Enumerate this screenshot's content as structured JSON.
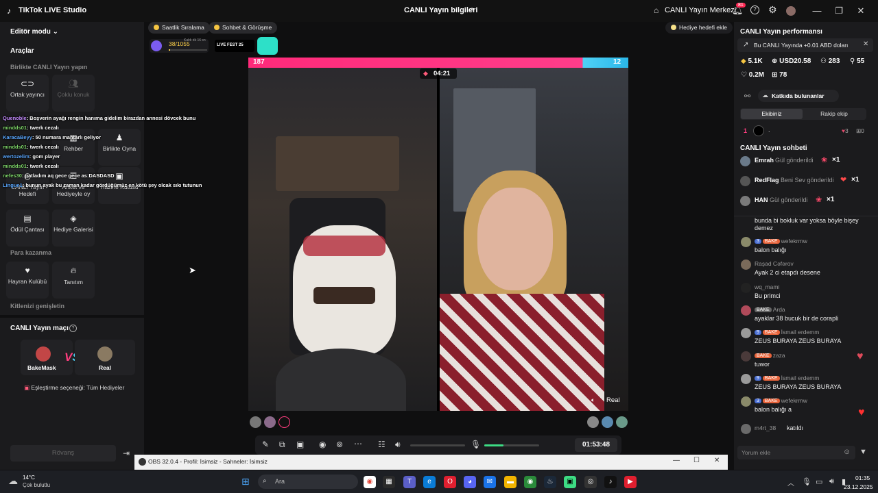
{
  "titlebar": {
    "app_title": "TikTok LIVE Studio",
    "center_title": "CANLI Yayın bilgileri",
    "live_center": "CANLI Yayın Merkezi",
    "notif_count": "81"
  },
  "left": {
    "editor_mode": "Editör modu",
    "tools_title": "Araçlar",
    "section_together": "Birlikte CANLI Yayın yapın",
    "tools": [
      {
        "label": "Ortak yayıncı"
      },
      {
        "label": "Çoklu konuk"
      },
      {
        "label": "Rehber"
      },
      {
        "label": "Birlikte Oyna"
      },
      {
        "label": "CANLI Yayın Hedefi"
      },
      {
        "label": "Anket ve Hediyeyle oy"
      },
      {
        "label": "Hazine Kutusu"
      },
      {
        "label": "Ödül Çantası"
      },
      {
        "label": "Hediye Galerisi"
      },
      {
        "label": "Hayran Kulübü"
      },
      {
        "label": "Tanıtım"
      }
    ],
    "section_money": "Para kazanma",
    "section_audience": "Kitlenizi genişletin",
    "match_title": "CANLI Yayın maçı",
    "player1": "BakeMask",
    "player2": "Real",
    "match_option": "Eşleştirme seçeneği: Tüm Hediyeler",
    "rematch": "Rövanş"
  },
  "overlay_chat": [
    {
      "user": "Quenoble",
      "text": ": Boşverin ayağı rengin hanıma gidelim birazdan annesi dövcek bunu"
    },
    {
      "user": "mindds01",
      "text": ": twerk cezalı"
    },
    {
      "user": "KaracaBeyy",
      "text": ": 50 numara mantarlı geliyor"
    },
    {
      "user": "mindds01",
      "text": ": twerk cezalı"
    },
    {
      "user": "wertozelim",
      "text": ": gom player"
    },
    {
      "user": "mindds01",
      "text": ": twerk cezalı"
    },
    {
      "user": "nefes30",
      "text": ": patladım aq gece gece as:DASDASD"
    },
    {
      "user": "Lingue1",
      "text": ": bunun ayak bu zaman kadar gördüğümüz en kötü şey olcak sıkı tutunun"
    }
  ],
  "center": {
    "pill1": "Saatlik Sıralama",
    "pill2": "Sohbet & Görüşme",
    "gift_goal": "Hediye hedefi ekle",
    "progress": "38/1055",
    "progress_value": 0.036,
    "progress_sub": "Kaldı dk 16 sn",
    "event": "LIVE FEST 25",
    "score_left": "187",
    "score_right": "12",
    "timer": "04:21",
    "right_name": "Real",
    "stream_time": "01:53:48"
  },
  "right": {
    "perf_title": "CANLI Yayın performansı",
    "perf_banner": "Bu CANLI Yayında +0.01 ABD doları",
    "stats": [
      "5.1K",
      "USD20.58",
      "283",
      "55",
      "0.2M",
      "78"
    ],
    "contributors": "Katkıda bulunanlar",
    "tab_team": "Ekibiniz",
    "tab_rival": "Rakip ekip",
    "rank_num": "1",
    "rank_name": ".",
    "rank_hearts": "3",
    "rank_gifts": "0",
    "chat_title": "CANLI Yayın sohbeti",
    "gifts": [
      {
        "name": "Emrah",
        "action": "Gül gönderildi",
        "count": "×1"
      },
      {
        "name": "RedFlag",
        "action": "Beni Sev gönderildi",
        "count": "×1"
      },
      {
        "name": "HAN",
        "action": "Gül gönderildi",
        "count": "×1"
      }
    ],
    "comments": [
      {
        "badges": [],
        "name": "",
        "msg": "bunda bi bokluk var yoksa böyle bişey"
      },
      {
        "badges": [],
        "name": "",
        "msg": "demez"
      },
      {
        "badges": [
          "3",
          "BAKE"
        ],
        "name": "wefekrmw",
        "msg": "balon balığı"
      },
      {
        "badges": [],
        "name": "Raşad Cəfərov",
        "msg": "Ayak 2 ci etapdı desene"
      },
      {
        "badges": [],
        "name": "wq_mami",
        "msg": "Bu primci"
      },
      {
        "badges": [
          "BAKE"
        ],
        "name": "Arda",
        "msg": "ayaklar 38 bucuk bir de corapli"
      },
      {
        "badges": [
          "9",
          "BAKE"
        ],
        "name": "İsmail erdemm",
        "msg": "ZEUS BURAYA ZEUS BURAYA"
      },
      {
        "badges": [
          "BAKE"
        ],
        "name": "zaza",
        "msg": "tuwor"
      },
      {
        "badges": [
          "9",
          "BAKE"
        ],
        "name": "İsmail erdemm",
        "msg": "ZEUS BURAYA ZEUS BURAYA"
      },
      {
        "badges": [
          "3",
          "BAKE"
        ],
        "name": "wefekrmw",
        "msg": "balon balığı a"
      },
      {
        "badges": [],
        "name": "m4rt_38",
        "msg": "katıldı"
      }
    ],
    "comment_placeholder": "Yorum ekle"
  },
  "obs": {
    "title": "OBS 32.0.4 - Profil: İsimsiz - Sahneler: İsimsiz"
  },
  "taskbar": {
    "weather_temp": "14°C",
    "weather_desc": "Çok bulutlu",
    "search_placeholder": "Ara",
    "time": "01:35",
    "date": "23.12.2025"
  },
  "colors": {
    "accent_pink": "#ff2a7a",
    "accent_blue": "#2bb7e8",
    "progress_green": "#3ddc84"
  }
}
